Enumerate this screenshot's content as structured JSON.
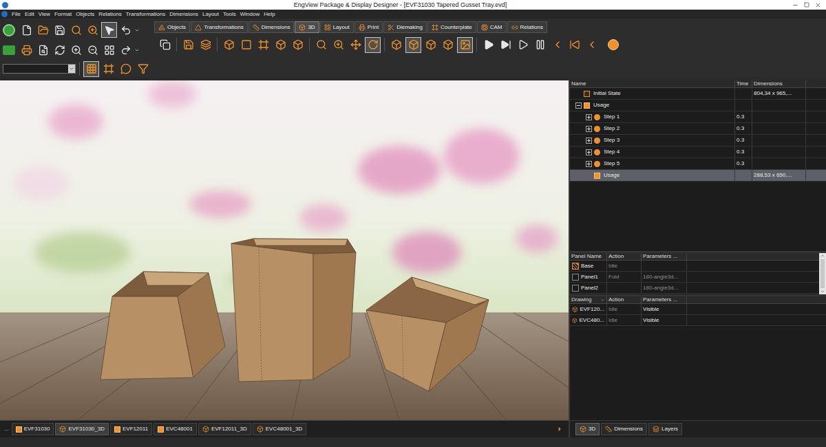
{
  "window": {
    "title": "EngView Package & Display Designer - [EVF31030 Tapered Gusset Tray.evd]"
  },
  "menu": [
    "File",
    "Edit",
    "View",
    "Format",
    "Objects",
    "Relations",
    "Transformations",
    "Dimensions",
    "Layout",
    "Tools",
    "Window",
    "Help"
  ],
  "toolbar": {
    "select_active": true
  },
  "ribbon_tabs": [
    {
      "label": "Objects",
      "selected": false
    },
    {
      "label": "Transformations",
      "selected": false
    },
    {
      "label": "Dimensions",
      "selected": false
    },
    {
      "label": "3D",
      "selected": true
    },
    {
      "label": "Layout",
      "selected": false
    },
    {
      "label": "Print",
      "selected": false
    },
    {
      "label": "Diemaking",
      "selected": false
    },
    {
      "label": "Counterplate",
      "selected": false
    },
    {
      "label": "CAM",
      "selected": false
    },
    {
      "label": "Relations",
      "selected": false
    }
  ],
  "tools_3d": [
    {
      "active": false
    },
    {
      "active": false
    },
    {
      "active": false
    },
    {
      "active": false
    },
    {
      "active": false
    },
    {
      "active": false
    },
    {
      "active": false
    },
    {
      "active": false
    },
    {
      "active": false
    },
    {
      "active": false
    },
    {
      "active": false
    },
    {
      "active": true
    },
    {
      "active": false
    },
    {
      "active": true
    },
    {
      "active": false
    },
    {
      "active": false
    },
    {
      "active": true
    }
  ],
  "combo": {
    "value": ""
  },
  "tree": {
    "columns": [
      "Name",
      "Time",
      "Dimensions"
    ],
    "rows": [
      {
        "name": "Initial State",
        "time": "",
        "dimensions": "804,34 x 965,...",
        "kind": "state",
        "depth": 0,
        "expandable": false,
        "expanded": false,
        "selected": false
      },
      {
        "name": "Usage",
        "time": "",
        "dimensions": "",
        "kind": "group",
        "depth": 0,
        "expandable": true,
        "expanded": true,
        "selected": false
      },
      {
        "name": "Step 1",
        "time": "0.3",
        "dimensions": "",
        "kind": "step",
        "depth": 1,
        "expandable": true,
        "expanded": false,
        "selected": false
      },
      {
        "name": "Step 2",
        "time": "0.3",
        "dimensions": "",
        "kind": "step",
        "depth": 1,
        "expandable": true,
        "expanded": false,
        "selected": false
      },
      {
        "name": "Step 3",
        "time": "0.3",
        "dimensions": "",
        "kind": "step",
        "depth": 1,
        "expandable": true,
        "expanded": false,
        "selected": false
      },
      {
        "name": "Step 4",
        "time": "0.3",
        "dimensions": "",
        "kind": "step",
        "depth": 1,
        "expandable": true,
        "expanded": false,
        "selected": false
      },
      {
        "name": "Step 5",
        "time": "0.3",
        "dimensions": "",
        "kind": "step",
        "depth": 1,
        "expandable": true,
        "expanded": false,
        "selected": false
      },
      {
        "name": "Usage",
        "time": "",
        "dimensions": "288,53 x 650,...",
        "kind": "result",
        "depth": 1,
        "expandable": false,
        "expanded": false,
        "selected": true
      }
    ]
  },
  "panels": {
    "columns": [
      "Panel Name",
      "Action",
      "Parameters ..."
    ],
    "rows": [
      {
        "name": "Base",
        "action": "Idle",
        "parameters": "",
        "kind": "base"
      },
      {
        "name": "Panel1",
        "action": "Fold",
        "parameters": "180-angle3d...",
        "kind": "panel"
      },
      {
        "name": "Panel2",
        "action": "",
        "parameters": "180-angle3d...",
        "kind": "panel"
      }
    ]
  },
  "drawings": {
    "columns": [
      "Drawing",
      "Action",
      "Parameters ..."
    ],
    "rows": [
      {
        "name": "EVF120...",
        "action": "Idle",
        "parameters": "Visible"
      },
      {
        "name": "EVC480...",
        "action": "Idle",
        "parameters": "Visible"
      }
    ]
  },
  "doc_tabs": {
    "overflow": "...",
    "tabs": [
      {
        "label": "EVF31030",
        "kind": "2d",
        "selected": false
      },
      {
        "label": "EVF31030_3D",
        "kind": "3d",
        "selected": true
      },
      {
        "label": "EVF12011",
        "kind": "2d",
        "selected": false
      },
      {
        "label": "EVC48001",
        "kind": "2d",
        "selected": false
      },
      {
        "label": "EVF12011_3D",
        "kind": "3d",
        "selected": false
      },
      {
        "label": "EVC48001_3D",
        "kind": "3d",
        "selected": false
      }
    ]
  },
  "side_tabs": [
    {
      "label": "3D",
      "selected": true
    },
    {
      "label": "Dimensions",
      "selected": false
    },
    {
      "label": "Layers",
      "selected": false
    }
  ]
}
